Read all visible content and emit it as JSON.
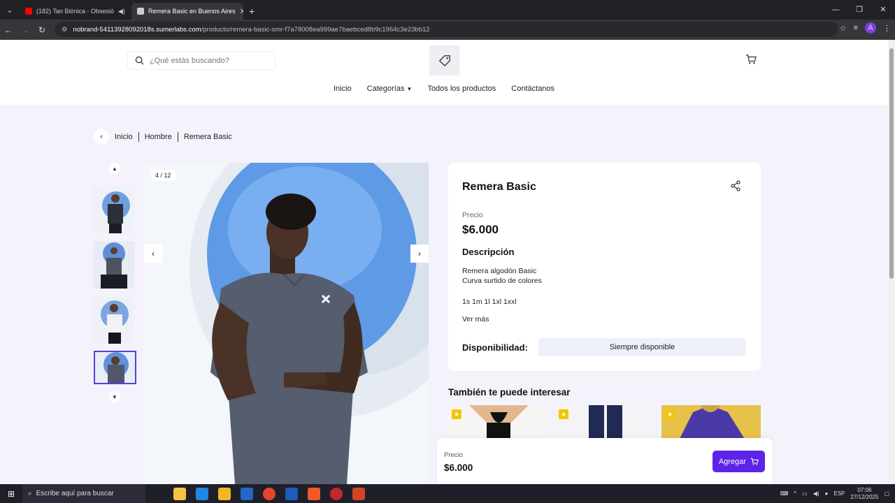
{
  "browser": {
    "tabs": [
      {
        "title": "(182) Tan Biónica - Obsesió",
        "active": false
      },
      {
        "title": "Remera Basic en Buenos Aires",
        "active": true
      }
    ],
    "url_host": "nobrand-54113928092018s.sumerlabs.com",
    "url_path": "/producto/remera-basic-smr-f7a78008ea999ae7baebced8b9c1964c3e23bb12",
    "profile_initial": "A"
  },
  "header": {
    "search_placeholder": "¿Qué estás buscando?",
    "menu": [
      "Inicio",
      "Categorías",
      "Todos los productos",
      "Contáctanos"
    ]
  },
  "breadcrumb": [
    "Inicio",
    "Hombre",
    "Remera Basic"
  ],
  "gallery": {
    "counter": "4 / 12"
  },
  "product": {
    "title": "Remera Basic",
    "price_label": "Precio",
    "price": "$6.000",
    "description_heading": "Descripción",
    "description_line1": "Remera algodón Basic",
    "description_line2": "Curva surtido de colores",
    "sizes": "1s 1m 1l 1xl 1xxl",
    "see_more": "Ver más",
    "availability_label": "Disponibilidad:",
    "availability_value": "Siempre disponible"
  },
  "related": {
    "heading": "También te puede interesar"
  },
  "sticky": {
    "price_label": "Precio",
    "price": "$6.000",
    "add_label": "Agregar"
  },
  "taskbar": {
    "search_text": "Escribe aquí para buscar",
    "lang": "ESP",
    "time": "07:06",
    "date": "27/12/2025"
  },
  "colors": {
    "accent": "#5b24e8",
    "page_bg": "#f4f2fb",
    "star": "#f5c400"
  }
}
